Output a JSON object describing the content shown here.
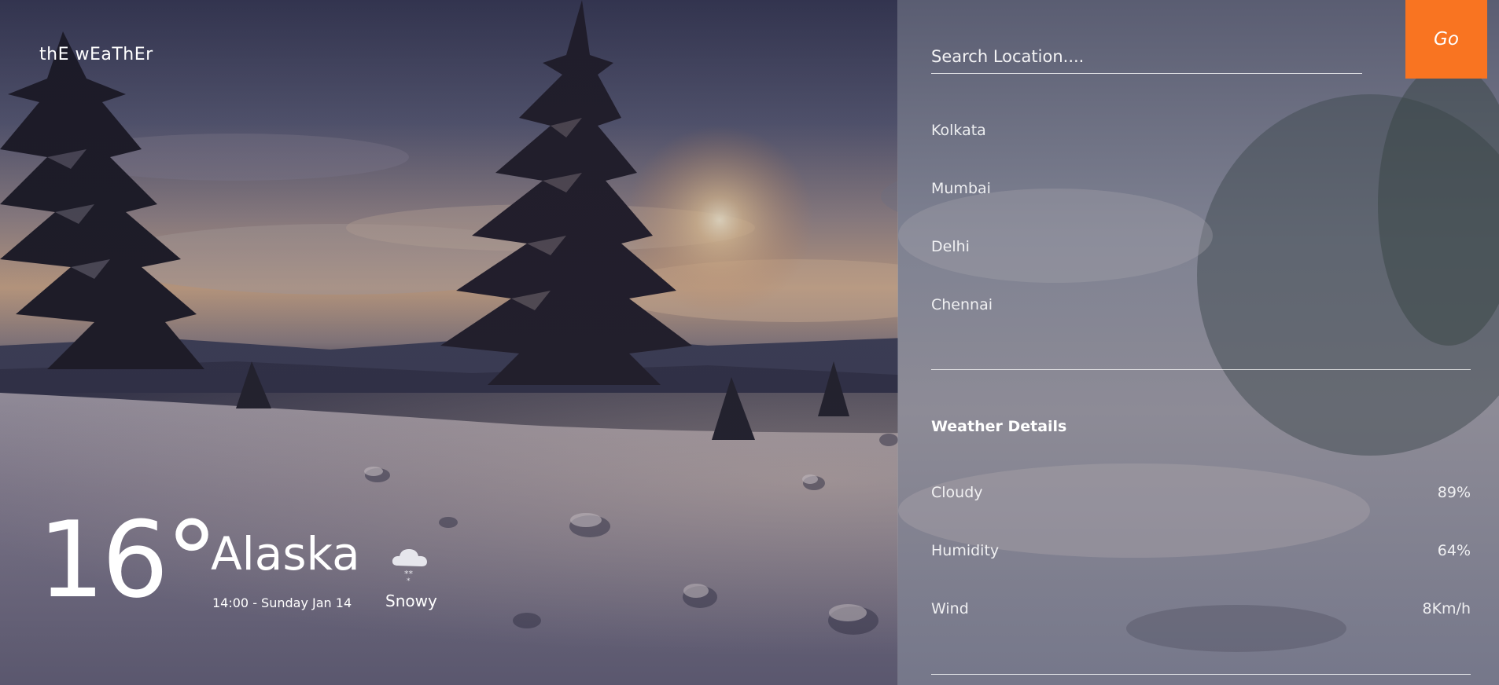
{
  "brand": "thE wEaThEr",
  "weather": {
    "temperature": "16°",
    "city": "Alaska",
    "datetime": "14:00 - Sunday Jan 14",
    "condition": "Snowy",
    "condition_icon": "snow-cloud-icon"
  },
  "search": {
    "placeholder": "Search Location....",
    "value": "",
    "go_label": "Go"
  },
  "locations": [
    "Kolkata",
    "Mumbai",
    "Delhi",
    "Chennai"
  ],
  "details": {
    "title": "Weather Details",
    "rows": [
      {
        "label": "Cloudy",
        "value": "89%"
      },
      {
        "label": "Humidity",
        "value": "64%"
      },
      {
        "label": "Wind",
        "value": "8Km/h"
      }
    ]
  },
  "colors": {
    "accent": "#f97421",
    "text": "#ffffff"
  }
}
